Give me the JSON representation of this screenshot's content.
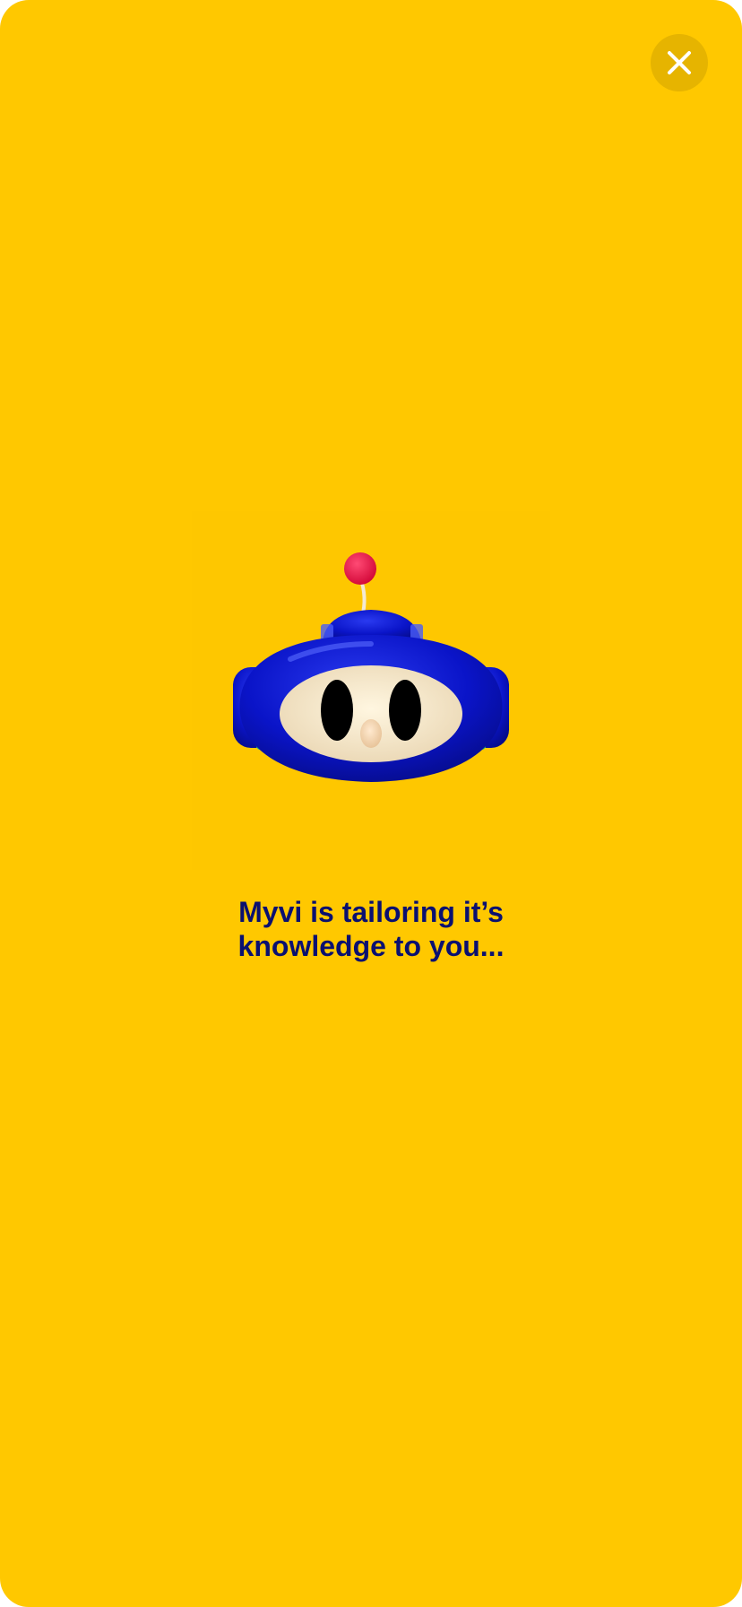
{
  "loading_screen": {
    "message": "Myvi is tailoring it’s\nknowledge to you...",
    "close_icon": "close-icon",
    "mascot_icon": "robot-mascot-icon"
  },
  "colors": {
    "background": "#FFC800",
    "close_button_bg": "#E6B400",
    "text": "#0A1070",
    "mascot_body": "#0A14C8",
    "mascot_face": "#F5E6C8",
    "antenna_ball": "#F0144B",
    "ear_ring": "#2ECC71"
  }
}
